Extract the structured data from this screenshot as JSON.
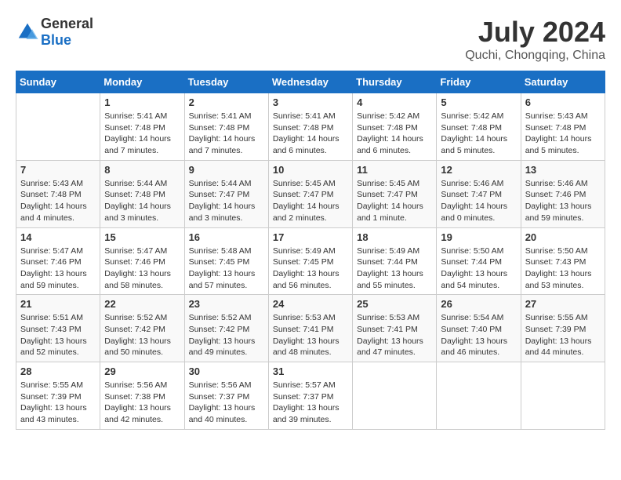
{
  "header": {
    "logo": {
      "general": "General",
      "blue": "Blue"
    },
    "title": "July 2024",
    "location": "Quchi, Chongqing, China"
  },
  "calendar": {
    "days_of_week": [
      "Sunday",
      "Monday",
      "Tuesday",
      "Wednesday",
      "Thursday",
      "Friday",
      "Saturday"
    ],
    "weeks": [
      [
        {
          "day": "",
          "sunrise": "",
          "sunset": "",
          "daylight": ""
        },
        {
          "day": "1",
          "sunrise": "Sunrise: 5:41 AM",
          "sunset": "Sunset: 7:48 PM",
          "daylight": "Daylight: 14 hours and 7 minutes."
        },
        {
          "day": "2",
          "sunrise": "Sunrise: 5:41 AM",
          "sunset": "Sunset: 7:48 PM",
          "daylight": "Daylight: 14 hours and 7 minutes."
        },
        {
          "day": "3",
          "sunrise": "Sunrise: 5:41 AM",
          "sunset": "Sunset: 7:48 PM",
          "daylight": "Daylight: 14 hours and 6 minutes."
        },
        {
          "day": "4",
          "sunrise": "Sunrise: 5:42 AM",
          "sunset": "Sunset: 7:48 PM",
          "daylight": "Daylight: 14 hours and 6 minutes."
        },
        {
          "day": "5",
          "sunrise": "Sunrise: 5:42 AM",
          "sunset": "Sunset: 7:48 PM",
          "daylight": "Daylight: 14 hours and 5 minutes."
        },
        {
          "day": "6",
          "sunrise": "Sunrise: 5:43 AM",
          "sunset": "Sunset: 7:48 PM",
          "daylight": "Daylight: 14 hours and 5 minutes."
        }
      ],
      [
        {
          "day": "7",
          "sunrise": "Sunrise: 5:43 AM",
          "sunset": "Sunset: 7:48 PM",
          "daylight": "Daylight: 14 hours and 4 minutes."
        },
        {
          "day": "8",
          "sunrise": "Sunrise: 5:44 AM",
          "sunset": "Sunset: 7:48 PM",
          "daylight": "Daylight: 14 hours and 3 minutes."
        },
        {
          "day": "9",
          "sunrise": "Sunrise: 5:44 AM",
          "sunset": "Sunset: 7:47 PM",
          "daylight": "Daylight: 14 hours and 3 minutes."
        },
        {
          "day": "10",
          "sunrise": "Sunrise: 5:45 AM",
          "sunset": "Sunset: 7:47 PM",
          "daylight": "Daylight: 14 hours and 2 minutes."
        },
        {
          "day": "11",
          "sunrise": "Sunrise: 5:45 AM",
          "sunset": "Sunset: 7:47 PM",
          "daylight": "Daylight: 14 hours and 1 minute."
        },
        {
          "day": "12",
          "sunrise": "Sunrise: 5:46 AM",
          "sunset": "Sunset: 7:47 PM",
          "daylight": "Daylight: 14 hours and 0 minutes."
        },
        {
          "day": "13",
          "sunrise": "Sunrise: 5:46 AM",
          "sunset": "Sunset: 7:46 PM",
          "daylight": "Daylight: 13 hours and 59 minutes."
        }
      ],
      [
        {
          "day": "14",
          "sunrise": "Sunrise: 5:47 AM",
          "sunset": "Sunset: 7:46 PM",
          "daylight": "Daylight: 13 hours and 59 minutes."
        },
        {
          "day": "15",
          "sunrise": "Sunrise: 5:47 AM",
          "sunset": "Sunset: 7:46 PM",
          "daylight": "Daylight: 13 hours and 58 minutes."
        },
        {
          "day": "16",
          "sunrise": "Sunrise: 5:48 AM",
          "sunset": "Sunset: 7:45 PM",
          "daylight": "Daylight: 13 hours and 57 minutes."
        },
        {
          "day": "17",
          "sunrise": "Sunrise: 5:49 AM",
          "sunset": "Sunset: 7:45 PM",
          "daylight": "Daylight: 13 hours and 56 minutes."
        },
        {
          "day": "18",
          "sunrise": "Sunrise: 5:49 AM",
          "sunset": "Sunset: 7:44 PM",
          "daylight": "Daylight: 13 hours and 55 minutes."
        },
        {
          "day": "19",
          "sunrise": "Sunrise: 5:50 AM",
          "sunset": "Sunset: 7:44 PM",
          "daylight": "Daylight: 13 hours and 54 minutes."
        },
        {
          "day": "20",
          "sunrise": "Sunrise: 5:50 AM",
          "sunset": "Sunset: 7:43 PM",
          "daylight": "Daylight: 13 hours and 53 minutes."
        }
      ],
      [
        {
          "day": "21",
          "sunrise": "Sunrise: 5:51 AM",
          "sunset": "Sunset: 7:43 PM",
          "daylight": "Daylight: 13 hours and 52 minutes."
        },
        {
          "day": "22",
          "sunrise": "Sunrise: 5:52 AM",
          "sunset": "Sunset: 7:42 PM",
          "daylight": "Daylight: 13 hours and 50 minutes."
        },
        {
          "day": "23",
          "sunrise": "Sunrise: 5:52 AM",
          "sunset": "Sunset: 7:42 PM",
          "daylight": "Daylight: 13 hours and 49 minutes."
        },
        {
          "day": "24",
          "sunrise": "Sunrise: 5:53 AM",
          "sunset": "Sunset: 7:41 PM",
          "daylight": "Daylight: 13 hours and 48 minutes."
        },
        {
          "day": "25",
          "sunrise": "Sunrise: 5:53 AM",
          "sunset": "Sunset: 7:41 PM",
          "daylight": "Daylight: 13 hours and 47 minutes."
        },
        {
          "day": "26",
          "sunrise": "Sunrise: 5:54 AM",
          "sunset": "Sunset: 7:40 PM",
          "daylight": "Daylight: 13 hours and 46 minutes."
        },
        {
          "day": "27",
          "sunrise": "Sunrise: 5:55 AM",
          "sunset": "Sunset: 7:39 PM",
          "daylight": "Daylight: 13 hours and 44 minutes."
        }
      ],
      [
        {
          "day": "28",
          "sunrise": "Sunrise: 5:55 AM",
          "sunset": "Sunset: 7:39 PM",
          "daylight": "Daylight: 13 hours and 43 minutes."
        },
        {
          "day": "29",
          "sunrise": "Sunrise: 5:56 AM",
          "sunset": "Sunset: 7:38 PM",
          "daylight": "Daylight: 13 hours and 42 minutes."
        },
        {
          "day": "30",
          "sunrise": "Sunrise: 5:56 AM",
          "sunset": "Sunset: 7:37 PM",
          "daylight": "Daylight: 13 hours and 40 minutes."
        },
        {
          "day": "31",
          "sunrise": "Sunrise: 5:57 AM",
          "sunset": "Sunset: 7:37 PM",
          "daylight": "Daylight: 13 hours and 39 minutes."
        },
        {
          "day": "",
          "sunrise": "",
          "sunset": "",
          "daylight": ""
        },
        {
          "day": "",
          "sunrise": "",
          "sunset": "",
          "daylight": ""
        },
        {
          "day": "",
          "sunrise": "",
          "sunset": "",
          "daylight": ""
        }
      ]
    ]
  }
}
